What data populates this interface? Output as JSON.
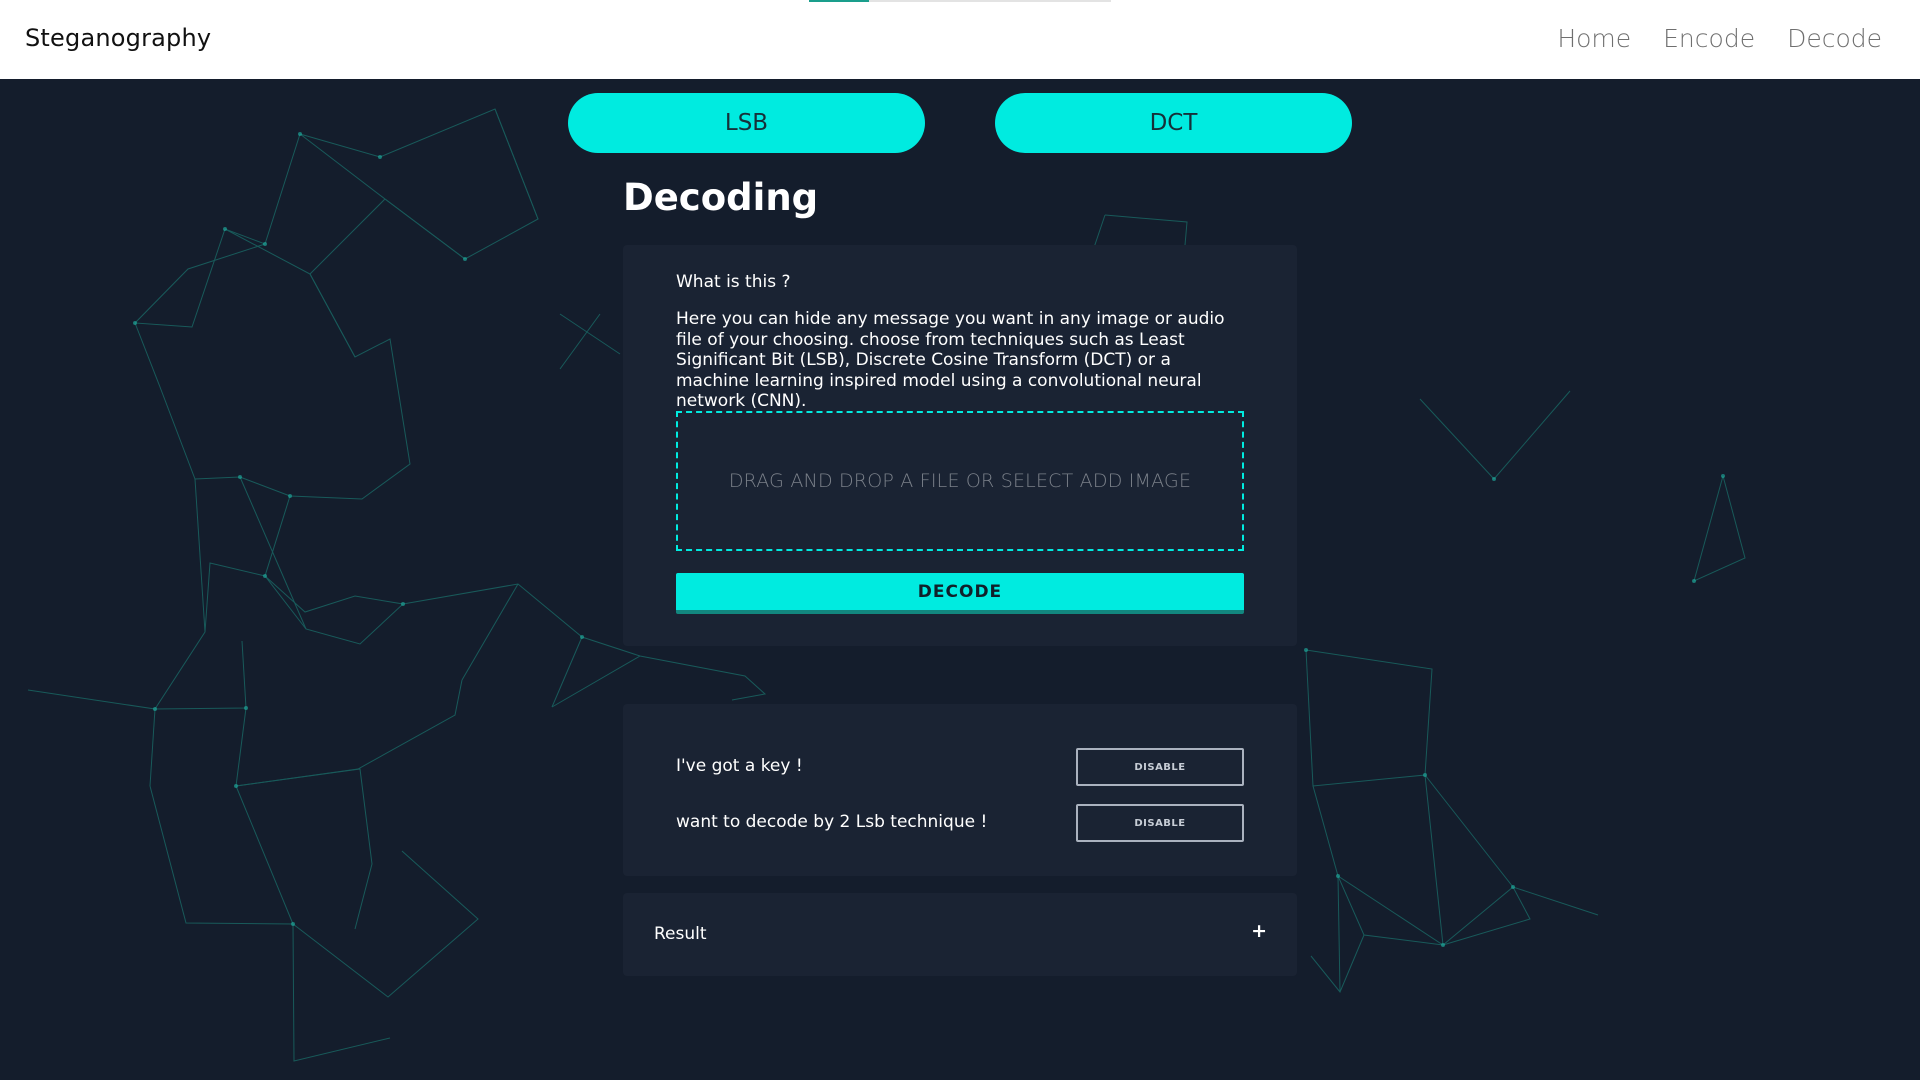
{
  "header": {
    "brand": "Steganography",
    "nav": [
      "Home",
      "Encode",
      "Decode"
    ],
    "loading_progress": 0.2
  },
  "tabs": [
    "LSB",
    "DCT"
  ],
  "page_title": "Decoding",
  "info_card": {
    "heading": "What is this ?",
    "description": "Here you can hide any message you want in any image or audio file of your choosing. choose from techniques such as Least Significant Bit (LSB), Discrete Cosine Transform (DCT) or a machine learning inspired model using a convolutional neural network (CNN).",
    "dropzone_text": "DRAG AND DROP A FILE OR SELECT ADD IMAGE",
    "decode_button": "DECODE"
  },
  "options": [
    {
      "label": "I've got a key !",
      "button": "DISABLE"
    },
    {
      "label": "want to decode by 2 Lsb technique !",
      "button": "DISABLE"
    }
  ],
  "result": {
    "label": "Result",
    "expand_icon": "+"
  },
  "colors": {
    "accent": "#00ebe0",
    "background": "#141d2c",
    "card": "#1a2333",
    "network_lines": "#1a8a80"
  }
}
